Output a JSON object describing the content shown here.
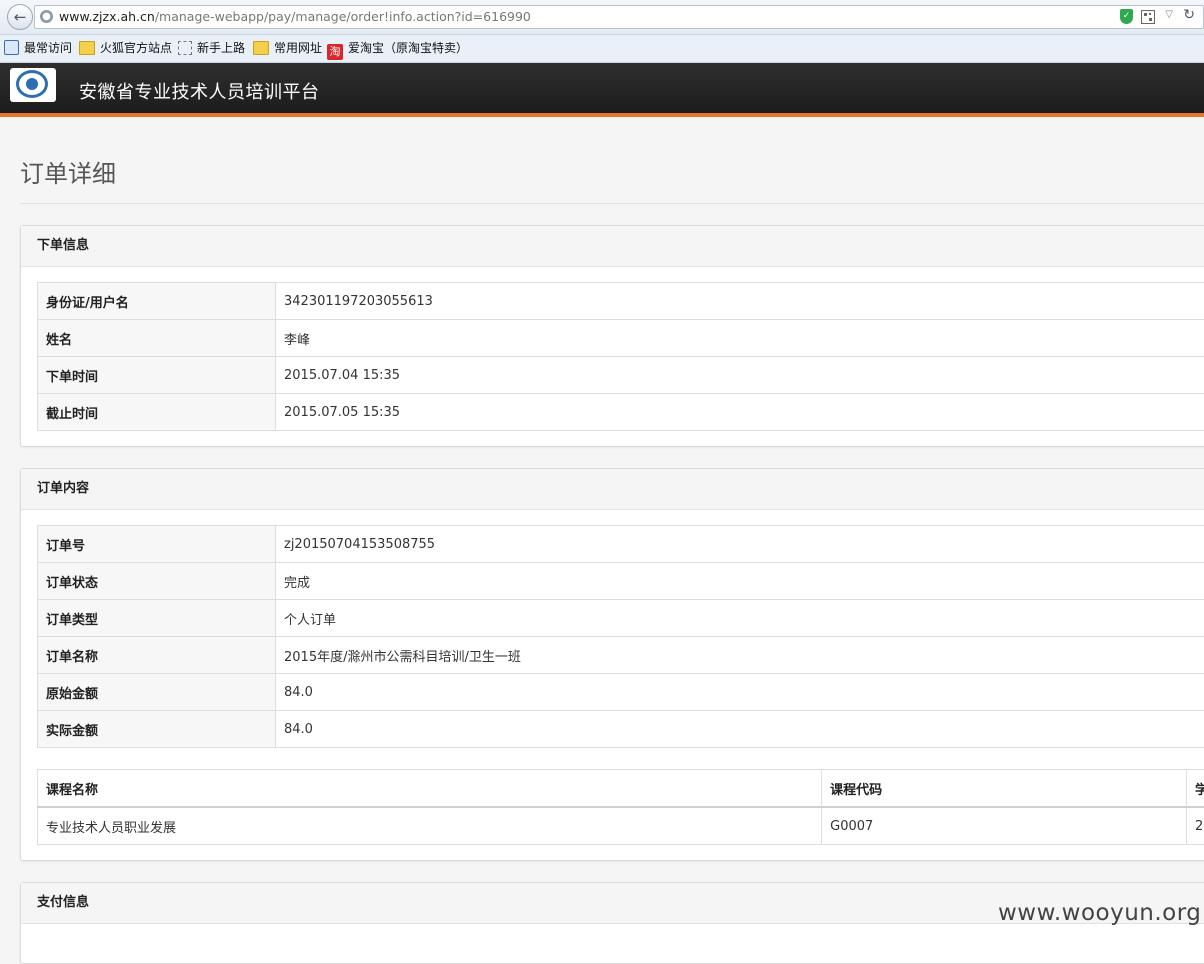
{
  "browser": {
    "url_host": "www.zjzx.ah.cn",
    "url_path": "/manage-webapp/pay/manage/order!info.action?id=616990",
    "bookmarks": [
      {
        "label": "最常访问",
        "icon": "search-icon"
      },
      {
        "label": "火狐官方站点",
        "icon": "folder-icon"
      },
      {
        "label": "新手上路",
        "icon": "page-icon"
      },
      {
        "label": "常用网址",
        "icon": "folder-icon"
      },
      {
        "label": "爱淘宝（原淘宝特卖）",
        "icon": "taobao-icon",
        "icon_text": "淘"
      }
    ]
  },
  "site": {
    "title": "安徽省专业技术人员培训平台",
    "accent_color": "#e8762a"
  },
  "page": {
    "heading": "订单详细"
  },
  "order_info": {
    "title": "下单信息",
    "rows": [
      {
        "label": "身份证/用户名",
        "value": "342301197203055613"
      },
      {
        "label": "姓名",
        "value": "李峰"
      },
      {
        "label": "下单时间",
        "value": "2015.07.04 15:35"
      },
      {
        "label": "截止时间",
        "value": "2015.07.05 15:35"
      }
    ]
  },
  "order_content": {
    "title": "订单内容",
    "rows": [
      {
        "label": "订单号",
        "value": "zj20150704153508755"
      },
      {
        "label": "订单状态",
        "value": "完成"
      },
      {
        "label": "订单类型",
        "value": "个人订单"
      },
      {
        "label": "订单名称",
        "value": "2015年度/滁州市公需科目培训/卫生一班"
      },
      {
        "label": "原始金额",
        "value": "84.0"
      },
      {
        "label": "实际金额",
        "value": "84.0"
      }
    ],
    "course_table": {
      "headers": [
        "课程名称",
        "课程代码",
        "学"
      ],
      "rows": [
        [
          "专业技术人员职业发展",
          "G0007",
          "2"
        ]
      ]
    }
  },
  "payment_info": {
    "title": "支付信息"
  },
  "watermark": "www.wooyun.org"
}
